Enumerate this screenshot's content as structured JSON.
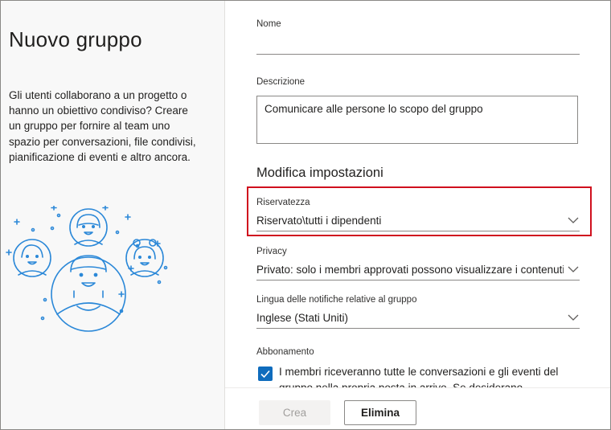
{
  "panel": {
    "title": "Nuovo gruppo",
    "description": "Gli utenti collaborano a un progetto o hanno un obiettivo condiviso? Creare un gruppo per fornire al team uno spazio per conversazioni, file condivisi, pianificazione di eventi e altro ancora."
  },
  "form": {
    "name_label": "Nome",
    "name_value": "",
    "description_label": "Descrizione",
    "description_placeholder": "Comunicare alle persone lo scopo del gruppo",
    "settings_heading": "Modifica impostazioni",
    "confidentiality_label": "Riservatezza",
    "confidentiality_value": "Riservato\\tutti i dipendenti",
    "privacy_label": "Privacy",
    "privacy_value": "Privato: solo i membri approvati possono visualizzare i contenuti",
    "language_label": "Lingua delle notifiche relative al gruppo",
    "language_value": "Inglese (Stati Uniti)",
    "subscription_label": "Abbonamento",
    "subscription_checked": true,
    "subscription_text": "I membri riceveranno tutte le conversazioni e gli eventi del gruppo nella propria posta in arrivo. Se desiderano"
  },
  "footer": {
    "create_label": "Crea",
    "delete_label": "Elimina"
  },
  "icons": {
    "dropdown": "chevron-down-icon",
    "checkbox": "checkmark-icon",
    "illustration": "people-group-illustration"
  },
  "colors": {
    "accent": "#0f6cbd",
    "highlight": "#d0101e",
    "illustration": "#2b88d8"
  }
}
